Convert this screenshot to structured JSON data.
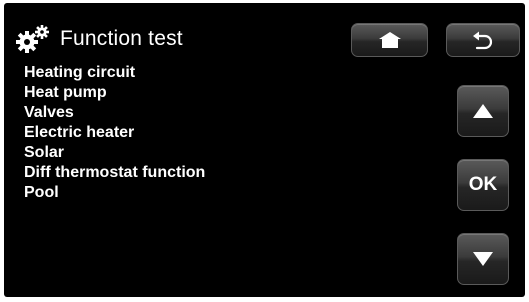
{
  "header": {
    "title": "Function test",
    "icon": "gears-icon"
  },
  "menu": {
    "items": [
      {
        "label": "Heating circuit"
      },
      {
        "label": "Heat pump"
      },
      {
        "label": "Valves"
      },
      {
        "label": "Electric heater"
      },
      {
        "label": "Solar"
      },
      {
        "label": "Diff thermostat function"
      },
      {
        "label": "Pool"
      }
    ]
  },
  "buttons": {
    "home_icon": "home-icon",
    "back_icon": "back-arrow-icon",
    "up_icon": "up-arrow-icon",
    "ok_label": "OK",
    "down_icon": "down-arrow-icon"
  },
  "colors": {
    "background": "#000000",
    "text": "#ffffff",
    "button_top": "#5a5a5a",
    "button_bottom": "#1a1a1a"
  }
}
